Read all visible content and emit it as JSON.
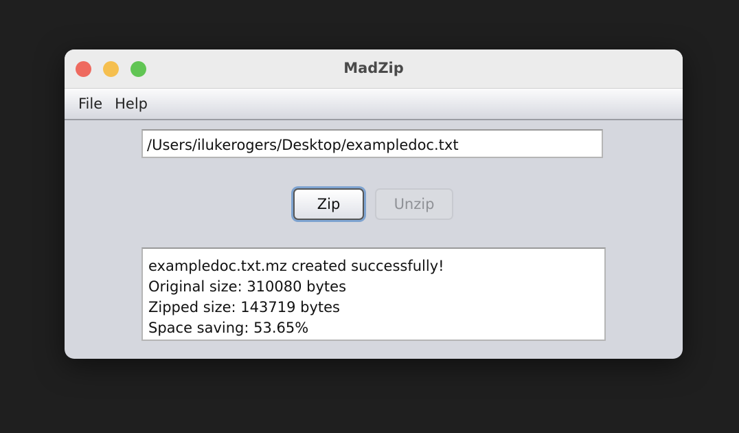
{
  "window": {
    "title": "MadZip"
  },
  "menu": [
    "File",
    "Help"
  ],
  "path_field": {
    "value": "/Users/ilukerogers/Desktop/exampledoc.txt"
  },
  "buttons": {
    "zip": "Zip",
    "unzip": "Unzip"
  },
  "output": [
    "exampledoc.txt.mz created successfully!",
    "Original size: 310080 bytes",
    "Zipped size: 143719 bytes",
    "Space saving: 53.65%"
  ],
  "colors": {
    "close": "#ee6a5f",
    "minimize": "#f5bf4f",
    "maximize": "#61c554",
    "focus_ring": "#7ea3d0"
  }
}
